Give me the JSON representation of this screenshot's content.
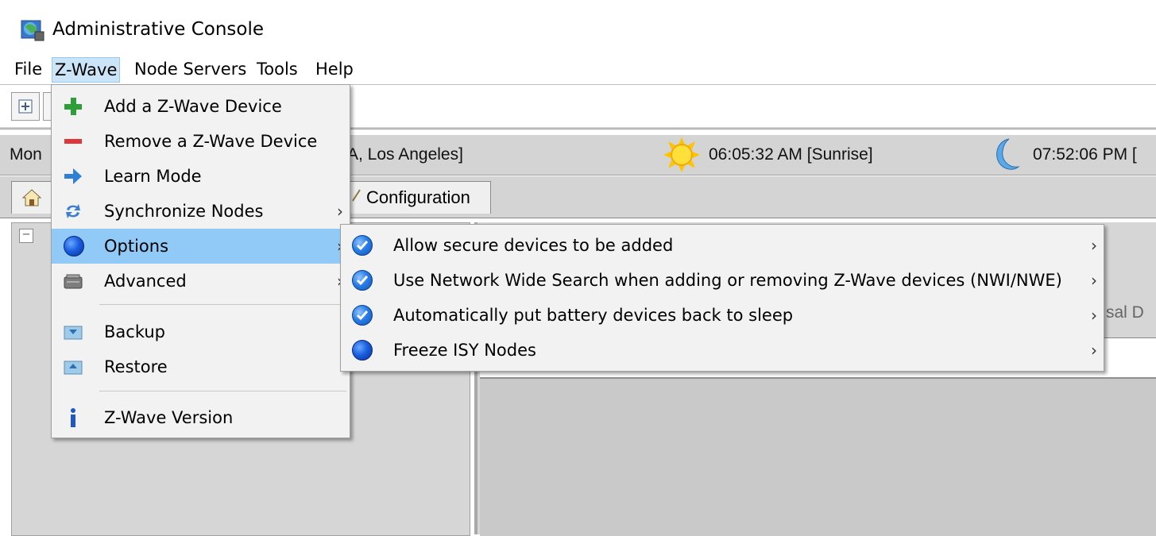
{
  "window": {
    "title": "Administrative Console"
  },
  "menubar": {
    "items": [
      "File",
      "Z-Wave",
      "Node Servers",
      "Tools",
      "Help"
    ],
    "active": "Z-Wave"
  },
  "statusbar": {
    "left_text": "Mon",
    "location_text": "A, Los Angeles]",
    "sunrise_text": "06:05:32 AM [Sunrise]",
    "sunset_text": "07:52:06 PM ["
  },
  "tabs": {
    "configuration_label": "Configuration"
  },
  "right_panel": {
    "partial_text": "sal D"
  },
  "zwave_menu": {
    "items": [
      {
        "label": "Add a Z-Wave Device",
        "icon": "plus-icon"
      },
      {
        "label": "Remove a Z-Wave Device",
        "icon": "minus-icon"
      },
      {
        "label": "Learn Mode",
        "icon": "arrow-right-icon"
      },
      {
        "label": "Synchronize Nodes",
        "icon": "sync-icon",
        "submenu": true
      },
      {
        "label": "Options",
        "icon": "options-dot-icon",
        "submenu": true,
        "highlighted": true
      },
      {
        "label": "Advanced",
        "icon": "advanced-icon",
        "submenu": true
      },
      {
        "label": "Backup",
        "icon": "backup-icon"
      },
      {
        "label": "Restore",
        "icon": "restore-icon"
      },
      {
        "label": "Z-Wave Version",
        "icon": "info-icon"
      }
    ]
  },
  "options_submenu": {
    "items": [
      {
        "label": "Allow secure devices to be added",
        "icon": "checked-icon"
      },
      {
        "label": "Use Network Wide Search when adding or removing Z-Wave devices (NWI/NWE)",
        "icon": "checked-icon"
      },
      {
        "label": "Automatically put battery devices back to sleep",
        "icon": "checked-icon"
      },
      {
        "label": "Freeze ISY Nodes",
        "icon": "radio-dot-icon"
      }
    ]
  }
}
